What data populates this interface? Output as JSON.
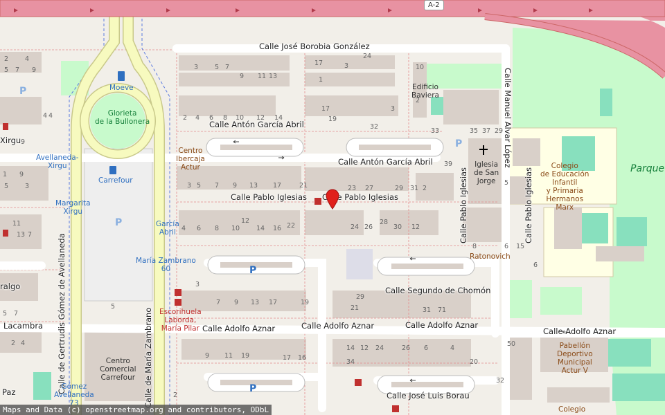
{
  "map": {
    "highway_ref": "A-2",
    "attribution": "Maps and Data (c) openstreetmap.org and contributors, ODbL",
    "streets": {
      "borobia": "Calle José Borobia González",
      "garcia_abril_1": "Calle Antón García Abril",
      "garcia_abril_2": "Calle Antón García Abril",
      "pablo_iglesias_1": "Calle Pablo Iglesias",
      "pablo_iglesias_2": "Calle Pablo Iglesias",
      "pablo_iglesias_v1": "Calle Pablo Iglesias",
      "pablo_iglesias_v2": "Calle Pablo Iglesias",
      "segundo_chomon": "Calle Segundo de Chomón",
      "adolfo_aznar_1": "Calle Adolfo Aznar",
      "adolfo_aznar_2": "Calle Adolfo Aznar",
      "adolfo_aznar_3": "Calle Adolfo Aznar",
      "adolfo_aznar_4": "Calle Adolfo Aznar",
      "jose_luis_borau": "Calle José Luis Borau",
      "manuel_alvar": "Calle Manuel Alvar López",
      "gertrudis": "Calle de Gertrudis Gómez de Avellaneda",
      "maria_zambrano": "Calle de María Zambrano",
      "lacambra": "Lacambra",
      "xirgu": "Xirgu",
      "ralgo": "ralgo",
      "paz": "Paz"
    },
    "pois": {
      "moeve": "Moeve",
      "glorieta": "Glorieta\nde la Bullonera",
      "avellaneda_xirgu": "Avellaneda-\nXirgu",
      "carrefour_small": "Carrefour",
      "margarita_xirgu": "Margarita\nXirgu",
      "garcia_abril_stop": "García\nAbril",
      "maria_zambrano_60": "María Zambrano\n60",
      "centro_ibercaja": "Centro\nIbercaja\nActur",
      "edificio_baviera": "Edificio\nBaviera",
      "iglesia": "Iglesia\nde San\nJorge",
      "colegio_educacion": "Colegio\nde Educación\nInfantil\ny Primaria\nHermanos\nMarx",
      "ratonovich": "Ratonovich",
      "escorihuela": "Escorihuela\nLaborda,\nMaría Pilar",
      "centro_comercial": "Centro\nComercial\nCarrefour",
      "gomez_avellaneda": "Gómez\nAvellaneda\n73",
      "pabellon": "Pabellón\nDeportivo\nMunicipal\nActur V",
      "colegio_bottom": "Colegio",
      "parque": "Parque\nde los Cinec"
    },
    "house_numbers": [
      {
        "t": "24"
      },
      {
        "t": "3"
      },
      {
        "t": "5"
      },
      {
        "t": "7"
      },
      {
        "t": "9"
      },
      {
        "t": "11"
      },
      {
        "t": "13"
      },
      {
        "t": "17"
      },
      {
        "t": "1"
      },
      {
        "t": "3"
      },
      {
        "t": "10"
      },
      {
        "t": "2"
      },
      {
        "t": "4"
      },
      {
        "t": "2"
      },
      {
        "t": "4"
      },
      {
        "t": "6"
      },
      {
        "t": "8"
      },
      {
        "t": "10"
      },
      {
        "t": "12"
      },
      {
        "t": "14"
      },
      {
        "t": "17"
      },
      {
        "t": "19"
      },
      {
        "t": "3"
      },
      {
        "t": "32"
      },
      {
        "t": "33"
      },
      {
        "t": "35"
      },
      {
        "t": "37"
      },
      {
        "t": "29"
      },
      {
        "t": "39"
      },
      {
        "t": "5"
      },
      {
        "t": "3"
      },
      {
        "t": "5"
      },
      {
        "t": "7"
      },
      {
        "t": "9"
      },
      {
        "t": "13"
      },
      {
        "t": "17"
      },
      {
        "t": "21"
      },
      {
        "t": "23"
      },
      {
        "t": "27"
      },
      {
        "t": "29"
      },
      {
        "t": "31"
      },
      {
        "t": "2"
      },
      {
        "t": "4"
      },
      {
        "t": "6"
      },
      {
        "t": "8"
      },
      {
        "t": "10"
      },
      {
        "t": "12"
      },
      {
        "t": "14"
      },
      {
        "t": "16"
      },
      {
        "t": "22"
      },
      {
        "t": "24"
      },
      {
        "t": "26"
      },
      {
        "t": "28"
      },
      {
        "t": "30"
      },
      {
        "t": "12"
      },
      {
        "t": "8"
      },
      {
        "t": "6"
      },
      {
        "t": "15"
      },
      {
        "t": "3"
      },
      {
        "t": "7"
      },
      {
        "t": "9"
      },
      {
        "t": "13"
      },
      {
        "t": "17"
      },
      {
        "t": "19"
      },
      {
        "t": "21"
      },
      {
        "t": "29"
      },
      {
        "t": "31"
      },
      {
        "t": "71"
      },
      {
        "t": "5"
      },
      {
        "t": "9"
      },
      {
        "t": "11"
      },
      {
        "t": "19"
      },
      {
        "t": "17"
      },
      {
        "t": "16"
      },
      {
        "t": "14"
      },
      {
        "t": "12"
      },
      {
        "t": "24"
      },
      {
        "t": "26"
      },
      {
        "t": "6"
      },
      {
        "t": "4"
      },
      {
        "t": "20"
      },
      {
        "t": "34"
      },
      {
        "t": "32"
      },
      {
        "t": "50"
      },
      {
        "t": "2"
      },
      {
        "t": "4"
      },
      {
        "t": "7"
      },
      {
        "t": "9"
      },
      {
        "t": "5"
      },
      {
        "t": "3"
      },
      {
        "t": "1"
      },
      {
        "t": "11"
      },
      {
        "t": "13"
      },
      {
        "t": "2"
      },
      {
        "t": "4"
      },
      {
        "t": "5"
      },
      {
        "t": "7"
      },
      {
        "t": "6"
      },
      {
        "t": "9"
      },
      {
        "t": "2"
      },
      {
        "t": "4"
      },
      {
        "t": "5"
      },
      {
        "t": "7"
      },
      {
        "t": "9"
      }
    ],
    "colors": {
      "background": "#f2efe9",
      "building": "#d9d0c9",
      "motorway": "#e892a2",
      "primary_road": "#fcd6a4",
      "secondary_road": "#f7fabf",
      "park": "#c8facc",
      "school": "#ffffe5",
      "sports": "#88e0be",
      "marker": "#e0201b"
    }
  }
}
